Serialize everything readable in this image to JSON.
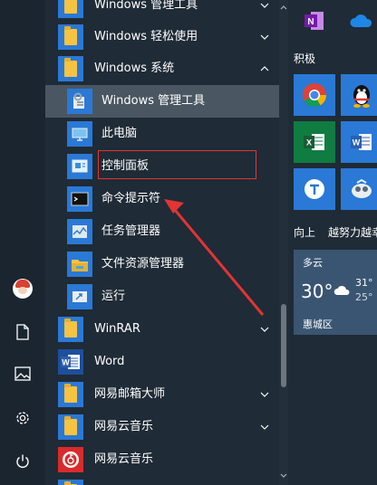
{
  "app_list": {
    "items": [
      {
        "label": "Windows 管理工具",
        "icon": "folder-icon",
        "chevron": "down"
      },
      {
        "label": "Windows 轻松使用",
        "icon": "folder-icon",
        "chevron": "down"
      },
      {
        "label": "Windows 系统",
        "icon": "folder-icon",
        "chevron": "up"
      },
      {
        "label": "Windows 管理工具",
        "icon": "admin-tools-icon",
        "sub": true,
        "highlighted": true
      },
      {
        "label": "此电脑",
        "icon": "this-pc-icon",
        "sub": true
      },
      {
        "label": "控制面板",
        "icon": "control-panel-icon",
        "sub": true,
        "boxed": true
      },
      {
        "label": "命令提示符",
        "icon": "cmd-icon",
        "sub": true
      },
      {
        "label": "任务管理器",
        "icon": "task-manager-icon",
        "sub": true
      },
      {
        "label": "文件资源管理器",
        "icon": "file-explorer-icon",
        "sub": true
      },
      {
        "label": "运行",
        "icon": "run-icon",
        "sub": true
      },
      {
        "label": "WinRAR",
        "icon": "folder-icon",
        "chevron": "down"
      },
      {
        "label": "Word",
        "icon": "word-icon"
      },
      {
        "label": "网易邮箱大师",
        "icon": "folder-icon",
        "chevron": "down"
      },
      {
        "label": "网易云音乐",
        "icon": "folder-icon",
        "chevron": "down"
      },
      {
        "label": "网易云音乐",
        "icon": "netease-music-icon"
      },
      {
        "label": "",
        "icon": "folder-icon",
        "chevron": "down"
      }
    ]
  },
  "tiles": {
    "group1_label": "积极",
    "group2_label": "向上",
    "group2_label_b": "越努力越幸",
    "weather": {
      "condition": "多云",
      "temp": "30°",
      "high": "31°",
      "low": "25°",
      "location": "惠城区"
    }
  },
  "colors": {
    "background": "#1f2b36",
    "highlight": "#4a5661",
    "annotation": "#e23434",
    "folder_tile": "#2a79d6"
  }
}
